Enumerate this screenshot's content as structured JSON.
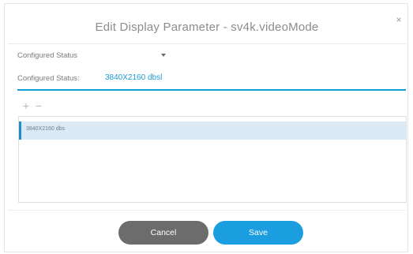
{
  "dialog": {
    "title": "Edit Display Parameter - sv4k.videoMode",
    "close_icon": "close-icon",
    "close_glyph": "×"
  },
  "form": {
    "dropdown": {
      "label": "Configured Status",
      "icon": "chevron-down-icon"
    },
    "status_field": {
      "label": "Configured Status:",
      "value": "3840X2160 dbsl"
    }
  },
  "toolbar": {
    "add_glyph": "+",
    "remove_glyph": "−",
    "add_icon": "plus-icon",
    "remove_icon": "minus-icon"
  },
  "list": {
    "items": [
      {
        "label": "3840X2160 dbs"
      }
    ]
  },
  "footer": {
    "cancel_label": "Cancel",
    "save_label": "Save"
  },
  "colors": {
    "accent": "#1b9ee0",
    "cancel": "#6c6c6c",
    "selected_row": "#dbe9f4"
  }
}
